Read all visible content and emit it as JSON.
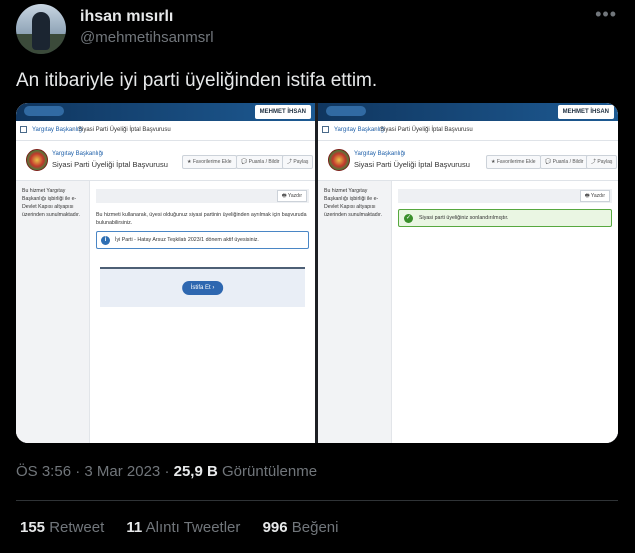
{
  "author": {
    "name": "ihsan mısırlı",
    "handle": "@mehmetihsanmsrl"
  },
  "tweet": {
    "text": "An itibariyle iyi parti üyeliğinden istifa ettim."
  },
  "screenshot_left": {
    "user_button": "MEHMET İHSAN",
    "breadcrumb_home": "Yargıtay Başkanlığı",
    "breadcrumb_sep": "›",
    "breadcrumb_current": "Siyasi Parti Üyeliği İptal Başvurusu",
    "header_org": "Yargıtay Başkanlığı",
    "header_title": "Siyasi Parti Üyeliği İptal Başvurusu",
    "btn_favorites": "★ Favorilerime Ekle",
    "btn_rate": "💬 Puanla / Bildir",
    "btn_share": "⤴ Paylaş",
    "sidebar_text": "Bu hizmet Yargıtay Başkanlığı işbirliği ile e-Devlet Kapısı altyapısı üzerinden sunulmaktadır.",
    "print_button": "🖶 Yazdır",
    "info_text": "Bu hizmeti kullanarak, üyesi olduğunuz siyasi partinin üyeliğinden ayrılmak için başvuruda bulunabilirsiniz.",
    "notice_text": "İyi Parti - Hatay Arsuz Teşkilatı 2023/1 dönem aktif üyesisiniz.",
    "action_button": "İstifa Et  ›"
  },
  "screenshot_right": {
    "user_button": "MEHMET İHSAN",
    "breadcrumb_home": "Yargıtay Başkanlığı",
    "breadcrumb_sep": "›",
    "breadcrumb_current": "Siyasi Parti Üyeliği İptal Başvurusu",
    "header_org": "Yargıtay Başkanlığı",
    "header_title": "Siyasi Parti Üyeliği İptal Başvurusu",
    "btn_favorites": "★ Favorilerime Ekle",
    "btn_rate": "💬 Puanla / Bildir",
    "btn_share": "⤴ Paylaş",
    "sidebar_text": "Bu hizmet Yargıtay Başkanlığı işbirliği ile e-Devlet Kapısı altyapısı üzerinden sunulmaktadır.",
    "print_button": "🖶 Yazdır",
    "success_text": "Siyasi parti üyeliğiniz sonlandırılmıştır."
  },
  "meta": {
    "time": "ÖS 3:56",
    "dot": "·",
    "date": "3 Mar 2023",
    "views_count": "25,9 B",
    "views_label": "Görüntülenme"
  },
  "stats": {
    "retweets_count": "155",
    "retweets_label": "Retweet",
    "quotes_count": "11",
    "quotes_label": "Alıntı Tweetler",
    "likes_count": "996",
    "likes_label": "Beğeni"
  },
  "colors": {
    "background": "#000000",
    "text_primary": "#e7e9ea",
    "text_secondary": "#71767b",
    "edevlet_blue": "#1d5a93",
    "success_green": "#3a8f2b"
  }
}
